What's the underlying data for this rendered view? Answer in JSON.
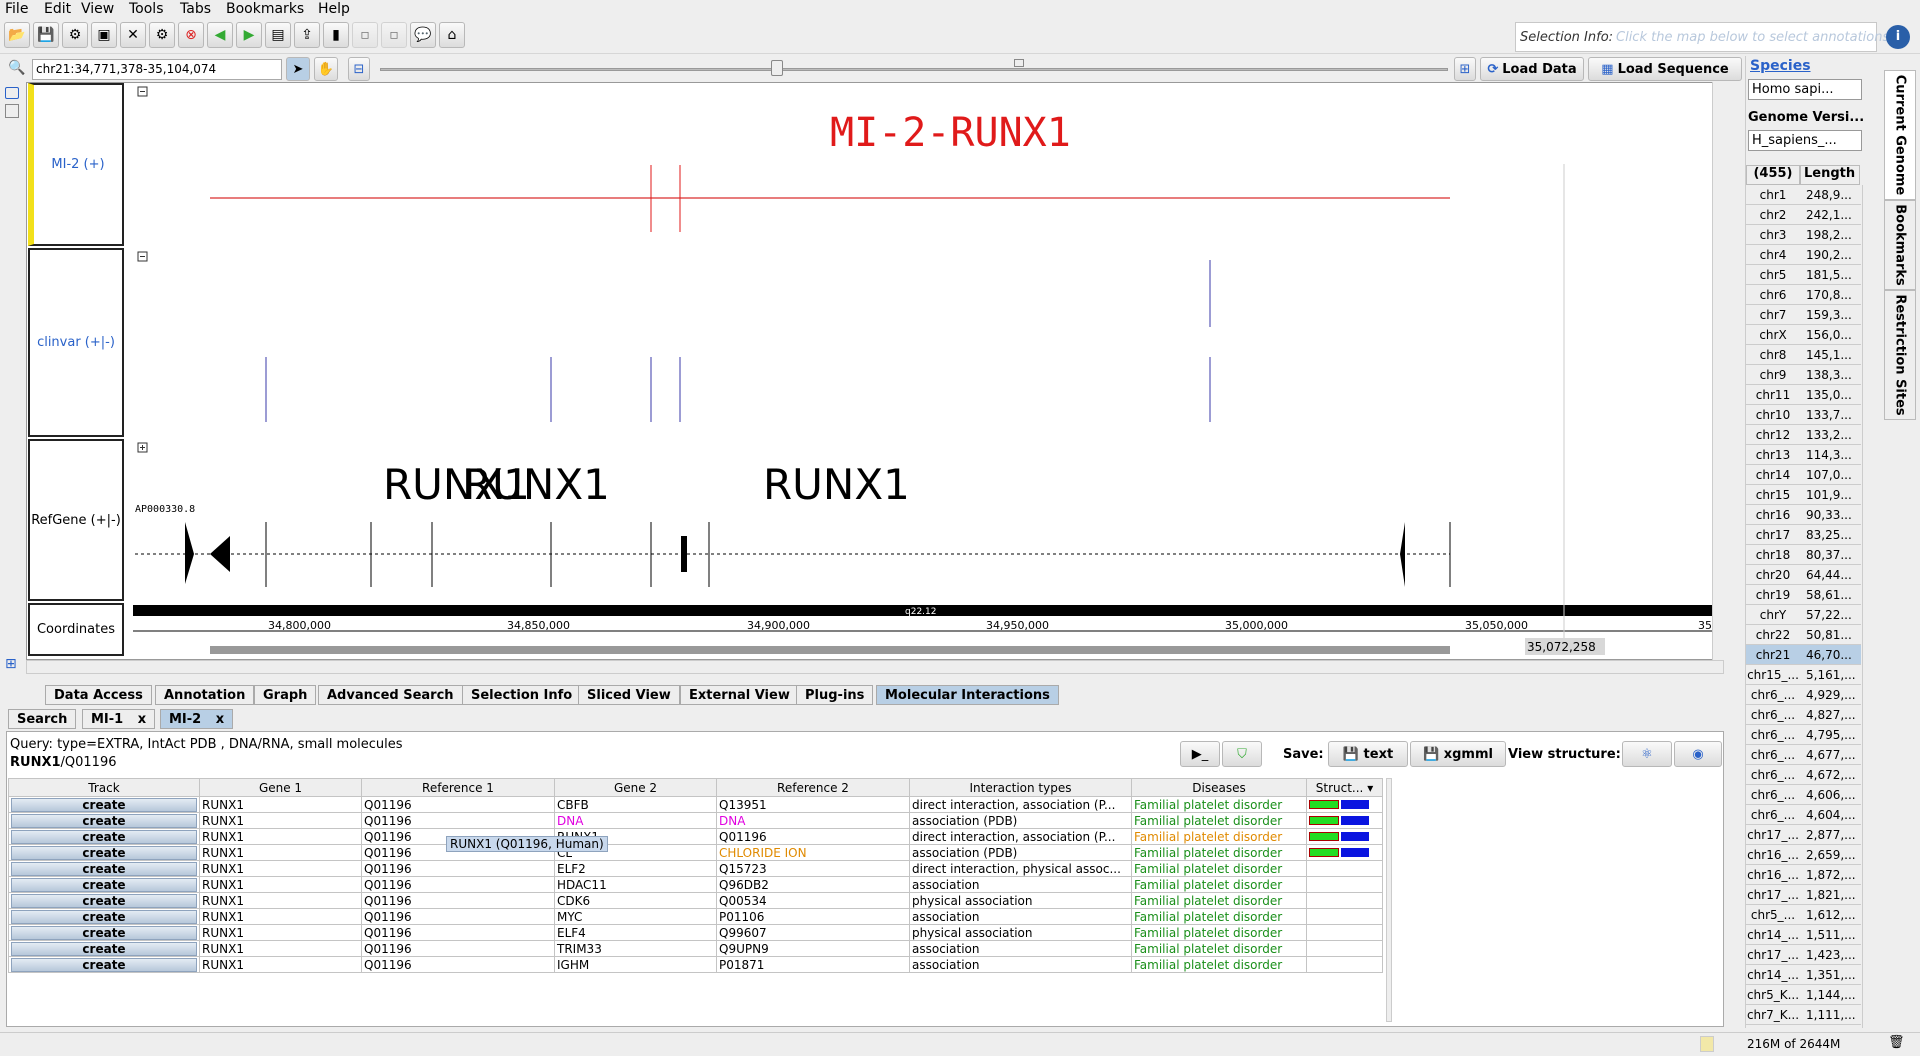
{
  "menu": [
    "File",
    "Edit",
    "View",
    "Tools",
    "Tabs",
    "Bookmarks",
    "Help"
  ],
  "selection_info": {
    "label": "Selection Info:",
    "placeholder": "Click the map below to select annotations"
  },
  "location": "chr21:34,771,378-35,104,074",
  "load_data": "Load Data",
  "load_sequence": "Load Sequence",
  "tracks": [
    {
      "label": "MI-2 (+)",
      "color": "#2a62c9"
    },
    {
      "label": "clinvar (+|-)",
      "color": "#2a62c9"
    },
    {
      "label": "RefGene (+|-)",
      "color": "#000000"
    },
    {
      "label": "Coordinates",
      "color": "#000000"
    }
  ],
  "mi_title": "MI-2-RUNX1",
  "gene_labels": [
    "RUNX1",
    "RUNX1",
    "RUNX1"
  ],
  "gene_small": "AP000330.8",
  "band": "q22.12",
  "coords": [
    "34,800,000",
    "34,850,000",
    "34,900,000",
    "34,950,000",
    "35,000,000",
    "35,050,000",
    "35,"
  ],
  "coord_marker": "35,072,258",
  "right": {
    "species_label": "Species",
    "species_value": "Homo sapi...",
    "genome_label": "Genome Versi...",
    "genome_value": "H_sapiens_...",
    "col_name": "(455) ...",
    "col_len": "Length",
    "chromosomes": [
      [
        "chr1",
        "248,9..."
      ],
      [
        "chr2",
        "242,1..."
      ],
      [
        "chr3",
        "198,2..."
      ],
      [
        "chr4",
        "190,2..."
      ],
      [
        "chr5",
        "181,5..."
      ],
      [
        "chr6",
        "170,8..."
      ],
      [
        "chr7",
        "159,3..."
      ],
      [
        "chrX",
        "156,0..."
      ],
      [
        "chr8",
        "145,1..."
      ],
      [
        "chr9",
        "138,3..."
      ],
      [
        "chr11",
        "135,0..."
      ],
      [
        "chr10",
        "133,7..."
      ],
      [
        "chr12",
        "133,2..."
      ],
      [
        "chr13",
        "114,3..."
      ],
      [
        "chr14",
        "107,0..."
      ],
      [
        "chr15",
        "101,9..."
      ],
      [
        "chr16",
        "90,33..."
      ],
      [
        "chr17",
        "83,25..."
      ],
      [
        "chr18",
        "80,37..."
      ],
      [
        "chr20",
        "64,44..."
      ],
      [
        "chr19",
        "58,61..."
      ],
      [
        "chrY",
        "57,22..."
      ],
      [
        "chr22",
        "50,81..."
      ],
      [
        "chr21",
        "46,70..."
      ],
      [
        "chr15_...",
        "5,161,..."
      ],
      [
        "chr6_...",
        "4,929,..."
      ],
      [
        "chr6_...",
        "4,827,..."
      ],
      [
        "chr6_...",
        "4,795,..."
      ],
      [
        "chr6_...",
        "4,677,..."
      ],
      [
        "chr6_...",
        "4,672,..."
      ],
      [
        "chr6_...",
        "4,606,..."
      ],
      [
        "chr6_...",
        "4,604,..."
      ],
      [
        "chr17_...",
        "2,877,..."
      ],
      [
        "chr16_...",
        "2,659,..."
      ],
      [
        "chr16_...",
        "1,872,..."
      ],
      [
        "chr17_...",
        "1,821,..."
      ],
      [
        "chr5_...",
        "1,612,..."
      ],
      [
        "chr14_...",
        "1,511,..."
      ],
      [
        "chr17_...",
        "1,423,..."
      ],
      [
        "chr14_...",
        "1,351,..."
      ],
      [
        "chr5_K...",
        "1,144,..."
      ],
      [
        "chr7_K...",
        "1,111,..."
      ]
    ],
    "vtabs": [
      "Current Genome",
      "Bookmarks",
      "Restriction Sites"
    ]
  },
  "bottom_tabs": [
    "Data Access",
    "Annotation",
    "Graph",
    "Advanced Search",
    "Selection Info",
    "Sliced View",
    "External View",
    "Plug-ins",
    "Molecular Interactions"
  ],
  "sub_tabs": [
    "Search",
    "MI-1",
    "MI-2"
  ],
  "query": "Query: type=EXTRA, IntAct PDB , DNA/RNA, small molecules",
  "query_gene": "RUNX1",
  "query_ref": "/Q01196",
  "save_label": "Save:",
  "save_text": "text",
  "save_xgmml": "xgmml",
  "view_structure": "View structure:",
  "columns": [
    "Track",
    "Gene 1",
    "Reference 1",
    "Gene 2",
    "Reference 2",
    "Interaction types",
    "Diseases",
    "Struct..."
  ],
  "rows": [
    [
      "create",
      "RUNX1",
      "Q01196",
      "CBFB",
      "Q13951",
      "direct interaction, association (P...",
      "Familial platelet disorder"
    ],
    [
      "create",
      "RUNX1",
      "Q01196",
      "DNA",
      "DNA",
      "association (PDB)",
      "Familial platelet disorder"
    ],
    [
      "create",
      "RUNX1",
      "Q01196",
      "RUNX1",
      "Q01196",
      "direct interaction, association (P...",
      "Familial platelet disorder"
    ],
    [
      "create",
      "RUNX1",
      "Q01196",
      "CL",
      "CHLORIDE ION",
      "association (PDB)",
      "Familial platelet disorder"
    ],
    [
      "create",
      "RUNX1",
      "Q01196",
      "ELF2",
      "Q15723",
      "direct interaction, physical assoc...",
      "Familial platelet disorder"
    ],
    [
      "create",
      "RUNX1",
      "Q01196",
      "HDAC11",
      "Q96DB2",
      "association",
      "Familial platelet disorder"
    ],
    [
      "create",
      "RUNX1",
      "Q01196",
      "CDK6",
      "Q00534",
      "physical association",
      "Familial platelet disorder"
    ],
    [
      "create",
      "RUNX1",
      "Q01196",
      "MYC",
      "P01106",
      "association",
      "Familial platelet disorder"
    ],
    [
      "create",
      "RUNX1",
      "Q01196",
      "ELF4",
      "Q99607",
      "physical association",
      "Familial platelet disorder"
    ],
    [
      "create",
      "RUNX1",
      "Q01196",
      "TRIM33",
      "Q9UPN9",
      "association",
      "Familial platelet disorder"
    ],
    [
      "create",
      "RUNX1",
      "Q01196",
      "IGHM",
      "P01871",
      "association",
      "Familial platelet disorder"
    ]
  ],
  "tooltip": "RUNX1 (Q01196, Human)",
  "memory": "216M of 2644M"
}
